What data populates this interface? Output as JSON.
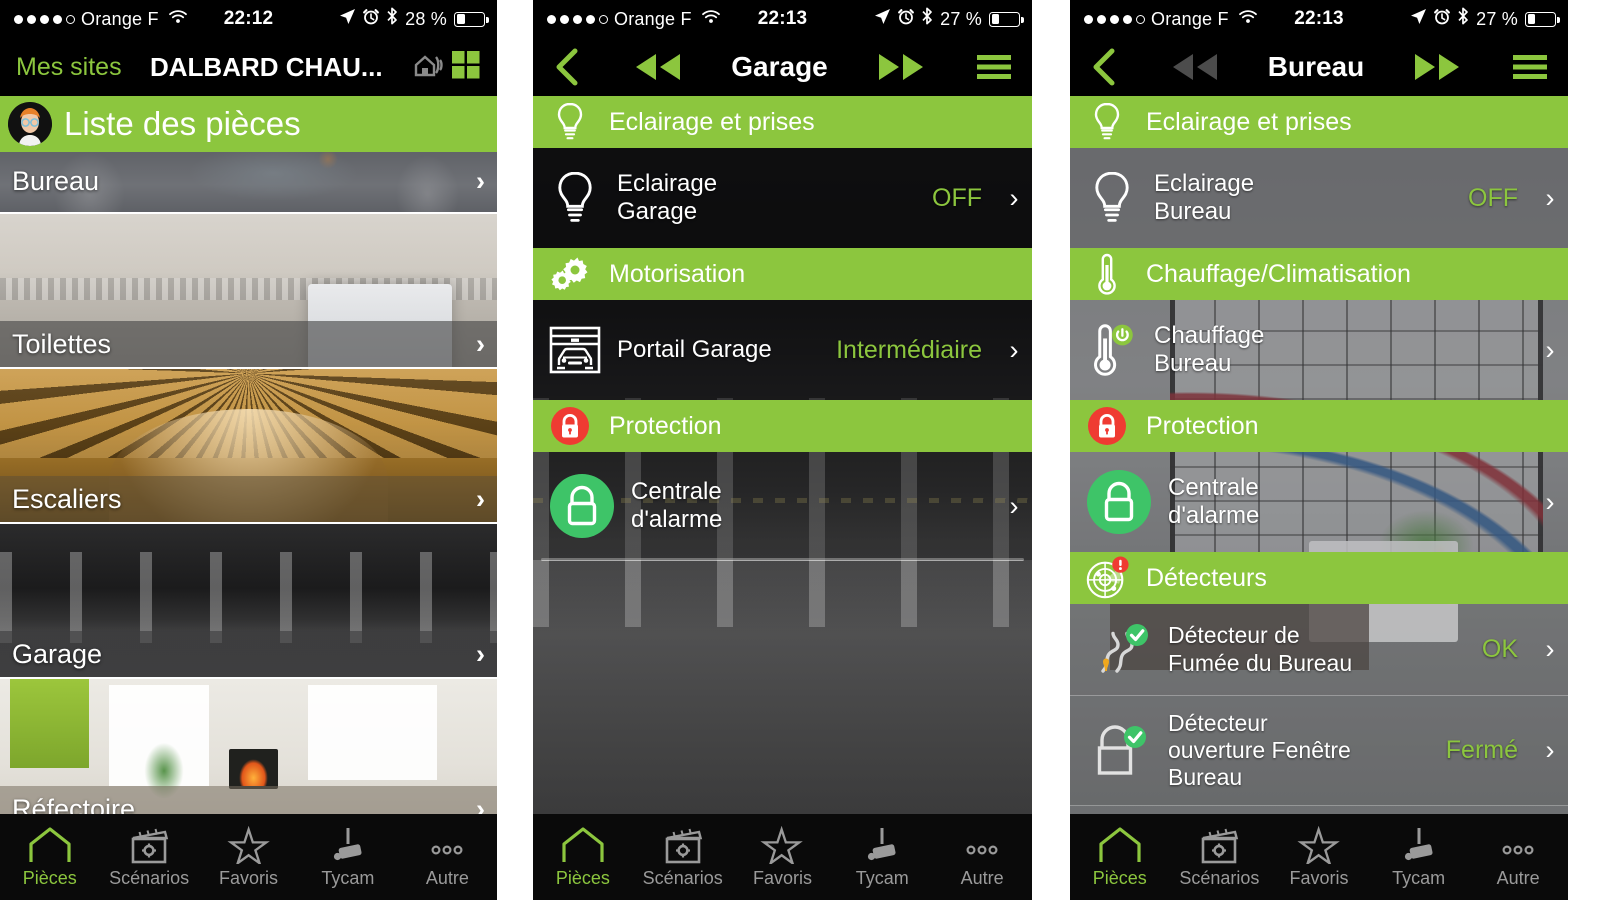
{
  "brand": {
    "green": "#8cc63e",
    "red": "#ef3b32",
    "greenBadge": "#3ec468",
    "amber": "#f0a81e"
  },
  "phone1": {
    "status": {
      "carrier": "Orange F",
      "time": "22:12",
      "battery_pct": "28 %",
      "battery_level": 28,
      "signal_dots": 5,
      "signal_filled": 4,
      "icons": [
        "location-arrow-icon",
        "alarm-clock-icon",
        "bluetooth-icon",
        "battery-icon",
        "wifi-icon"
      ]
    },
    "nav": {
      "back_label": "Mes sites",
      "title": "DALBARD CHAU...",
      "right_icons": [
        "home-signal-icon",
        "grid-squares-icon"
      ]
    },
    "header": {
      "title": "Liste des pièces",
      "avatar": "user-avatar"
    },
    "rooms": [
      {
        "name": "Bureau",
        "chevron": "›"
      },
      {
        "name": "Toilettes",
        "chevron": "›"
      },
      {
        "name": "Escaliers",
        "chevron": "›"
      },
      {
        "name": "Garage",
        "chevron": "›"
      },
      {
        "name": "Réfectoire",
        "chevron": "›"
      }
    ],
    "tabs": [
      {
        "label": "Pièces",
        "icon": "home-icon",
        "active": true
      },
      {
        "label": "Scénarios",
        "icon": "clapperboard-gear-icon",
        "active": false
      },
      {
        "label": "Favoris",
        "icon": "star-icon",
        "active": false
      },
      {
        "label": "Tycam",
        "icon": "camera-icon",
        "active": false
      },
      {
        "label": "Autre",
        "icon": "ellipsis-icon",
        "active": false
      }
    ]
  },
  "phone2": {
    "status": {
      "carrier": "Orange F",
      "time": "22:13",
      "battery_pct": "27 %",
      "battery_level": 27,
      "signal_dots": 5,
      "signal_filled": 4
    },
    "nav": {
      "title": "Garage",
      "back_icon": "chevron-left-icon",
      "prev_icon": "rewind-icon",
      "next_icon": "fast-forward-icon",
      "menu_icon": "hamburger-icon",
      "prev_enabled": true,
      "next_enabled": true
    },
    "sections": [
      {
        "type": "category",
        "label": "Eclairage et prises",
        "icon": "lightbulb-icon"
      },
      {
        "type": "device",
        "label": "Eclairage\nGarage",
        "icon": "lightbulb-icon",
        "state": "OFF",
        "chevron": "›"
      },
      {
        "type": "category",
        "label": "Motorisation",
        "icon": "gears-icon"
      },
      {
        "type": "device",
        "label": "Portail Garage",
        "icon": "garage-door-car-icon",
        "state": "Intermédiaire",
        "chevron": "›"
      },
      {
        "type": "category",
        "label": "Protection",
        "icon": "lock-red-icon"
      },
      {
        "type": "device",
        "label": "Centrale\nd'alarme",
        "icon": "padlock-green-icon",
        "state": "",
        "chevron": "›"
      }
    ],
    "tabs": [
      {
        "label": "Pièces",
        "icon": "home-icon",
        "active": true
      },
      {
        "label": "Scénarios",
        "icon": "clapperboard-gear-icon",
        "active": false
      },
      {
        "label": "Favoris",
        "icon": "star-icon",
        "active": false
      },
      {
        "label": "Tycam",
        "icon": "camera-icon",
        "active": false
      },
      {
        "label": "Autre",
        "icon": "ellipsis-icon",
        "active": false
      }
    ]
  },
  "phone3": {
    "status": {
      "carrier": "Orange F",
      "time": "22:13",
      "battery_pct": "27 %",
      "battery_level": 27,
      "signal_dots": 5,
      "signal_filled": 4
    },
    "nav": {
      "title": "Bureau",
      "back_icon": "chevron-left-icon",
      "prev_icon": "rewind-icon",
      "next_icon": "fast-forward-icon",
      "menu_icon": "hamburger-icon",
      "prev_enabled": false,
      "next_enabled": true
    },
    "sections": [
      {
        "type": "category",
        "label": "Eclairage et prises",
        "icon": "lightbulb-icon"
      },
      {
        "type": "device",
        "label": "Eclairage\nBureau",
        "icon": "lightbulb-icon",
        "state": "OFF",
        "chevron": "›"
      },
      {
        "type": "category",
        "label": "Chauffage/Climatisation",
        "icon": "thermometer-icon"
      },
      {
        "type": "device",
        "label": "Chauffage\nBureau",
        "icon": "thermometer-power-icon",
        "state": "",
        "chevron": "›"
      },
      {
        "type": "category",
        "label": "Protection",
        "icon": "lock-red-icon"
      },
      {
        "type": "device",
        "label": "Centrale\nd'alarme",
        "icon": "padlock-green-icon",
        "state": "",
        "chevron": "›"
      },
      {
        "type": "category",
        "label": "Détecteurs",
        "icon": "radar-alert-icon"
      },
      {
        "type": "device",
        "label": "Détecteur de\nFumée du Bureau",
        "icon": "smoke-detector-icon",
        "state": "OK",
        "chevron": "›"
      },
      {
        "type": "device",
        "label": "Détecteur\nouverture Fenêtre\nBureau",
        "icon": "window-lock-icon",
        "state": "Fermé",
        "chevron": "›"
      }
    ],
    "tabs": [
      {
        "label": "Pièces",
        "icon": "home-icon",
        "active": true
      },
      {
        "label": "Scénarios",
        "icon": "clapperboard-gear-icon",
        "active": false
      },
      {
        "label": "Favoris",
        "icon": "star-icon",
        "active": false
      },
      {
        "label": "Tycam",
        "icon": "camera-icon",
        "active": false
      },
      {
        "label": "Autre",
        "icon": "ellipsis-icon",
        "active": false
      }
    ]
  }
}
